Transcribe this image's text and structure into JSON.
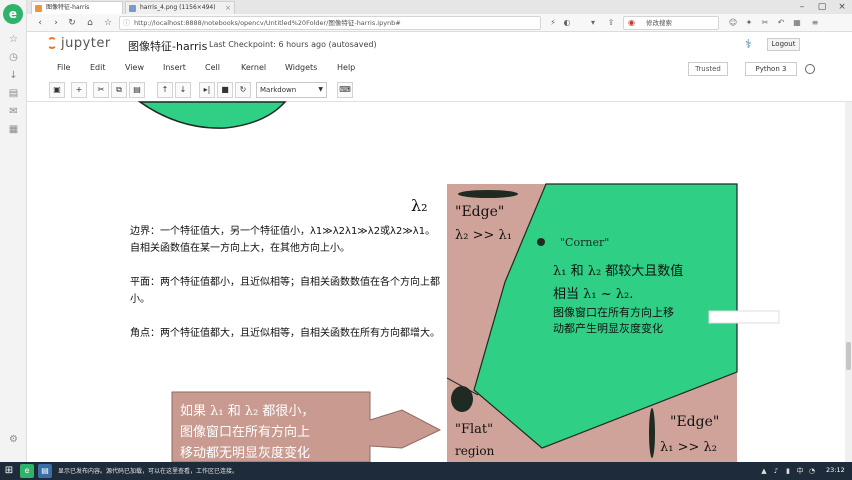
{
  "browser": {
    "logo": "e",
    "tabs": [
      {
        "label": "图像特征-harris"
      },
      {
        "label": "harris_4.png (1156×494)"
      }
    ],
    "url": "http://localhost:8888/notebooks/opencv/Untitled%20Folder/图像特征-harris.ipynb#",
    "search_text": "修改搜索"
  },
  "jupyter": {
    "logo_text": "jupyter",
    "notebook_title": "图像特征-harris",
    "checkpoint": "Last Checkpoint: 6 hours ago (autosaved)",
    "logout_label": "Logout"
  },
  "menu": {
    "items": [
      "File",
      "Edit",
      "View",
      "Insert",
      "Cell",
      "Kernel",
      "Widgets",
      "Help"
    ],
    "trusted": "Trusted",
    "kernel": "Python 3"
  },
  "toolbar": {
    "celltype": "Markdown"
  },
  "notebook": {
    "paragraphs": [
      "边界：一个特征值大，另一个特征值小，λ1≫λ2λ1≫λ2或λ2≫λ1。自相关函数值在某一方向上大，在其他方向上小。",
      "平面：两个特征值都小，且近似相等；自相关函数数值在各个方向上都小。",
      "角点：两个特征值都大，且近似相等，自相关函数在所有方向都增大。"
    ]
  },
  "figure": {
    "lambda2": "λ₂",
    "edge_top_1": "\"Edge\"",
    "edge_top_2": "λ₂ >> λ₁",
    "corner_label": "\"Corner\"",
    "corner_line1": "λ₁ 和 λ₂ 都较大且数值",
    "corner_line2": "相当 λ₁ ~ λ₂.",
    "corner_line3": "图像窗口在所有方向上移",
    "corner_line4": "动都产生明显灰度变化",
    "flat_label": "\"Flat\"",
    "flat_region": "region",
    "edge_bottom_1": "\"Edge\"",
    "edge_bottom_2": "λ₁ >> λ₂",
    "callout_line1": "如果 λ₁ 和 λ₂ 都很小，",
    "callout_line2": "图像窗口在所有方向上",
    "callout_line3": "移动都无明显灰度变化",
    "colors": {
      "pink": "#cfa39a",
      "green": "#2fcf86",
      "dark": "#1e2a22",
      "callout": "#c99a90"
    }
  },
  "taskbar": {
    "notification": "显示已发布内容。源代码已加载，可以在这里查看，工作区已连接。",
    "time": "23:12"
  }
}
